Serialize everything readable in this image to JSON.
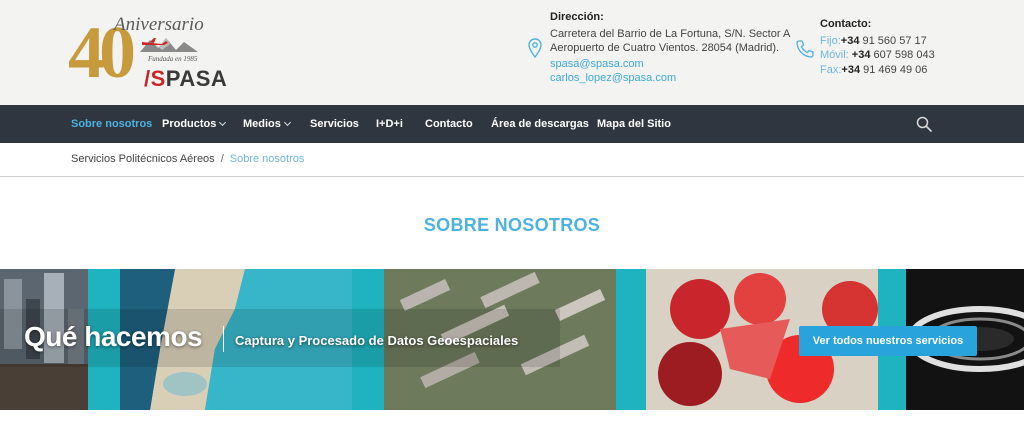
{
  "logo": {
    "number": "40",
    "anniversary": "Aniversario",
    "founded": "Fundada en 1985",
    "brand_prefix": "/S",
    "brand_rest": "PASA"
  },
  "address": {
    "title": "Dirección:",
    "line1": "Carretera del Barrio de La Fortuna, S/N. Sector A",
    "line2": "Aeropuerto de Cuatro Vientos. 28054 (Madrid).",
    "email1": "spasa@spasa.com",
    "email2": "carlos_lopez@spasa.com"
  },
  "contact": {
    "title": "Contacto:",
    "rows": [
      {
        "label": "Fijo:",
        "prefix": "+34",
        "number": " 91 560 57 17"
      },
      {
        "label": "Móvil:",
        "prefix": " +34",
        "number": " 607 598 043"
      },
      {
        "label": "Fax:",
        "prefix": "+34",
        "number": " 91 469 49 06"
      }
    ]
  },
  "nav": {
    "items": [
      {
        "label": "Sobre nosotros",
        "active": true,
        "dropdown": false
      },
      {
        "label": "Productos",
        "active": false,
        "dropdown": true
      },
      {
        "label": "Medios",
        "active": false,
        "dropdown": true
      },
      {
        "label": "Servicios",
        "active": false,
        "dropdown": false
      },
      {
        "label": "I+D+i",
        "active": false,
        "dropdown": false
      },
      {
        "label": "Contacto",
        "active": false,
        "dropdown": false
      },
      {
        "label": "Área de descargas",
        "active": false,
        "dropdown": false
      },
      {
        "label": "Mapa del Sitio",
        "active": false,
        "dropdown": false
      }
    ],
    "search_icon": "search-icon"
  },
  "breadcrumb": {
    "home": "Servicios Politécnicos Aéreos",
    "separator": "/",
    "current": "Sobre nosotros"
  },
  "page": {
    "title": "SOBRE NOSOTROS"
  },
  "banner": {
    "heading": "Qué hacemos",
    "subheading": "Captura y Procesado de Datos Geoespaciales",
    "button": "Ver todos nuestros servicios"
  },
  "colors": {
    "accent": "#4cb2e0",
    "nav_bg": "#2f3640",
    "teal": "#1fb3c0",
    "button": "#29a3dc",
    "brand_red": "#c62828",
    "gold": "#c79a3c"
  }
}
